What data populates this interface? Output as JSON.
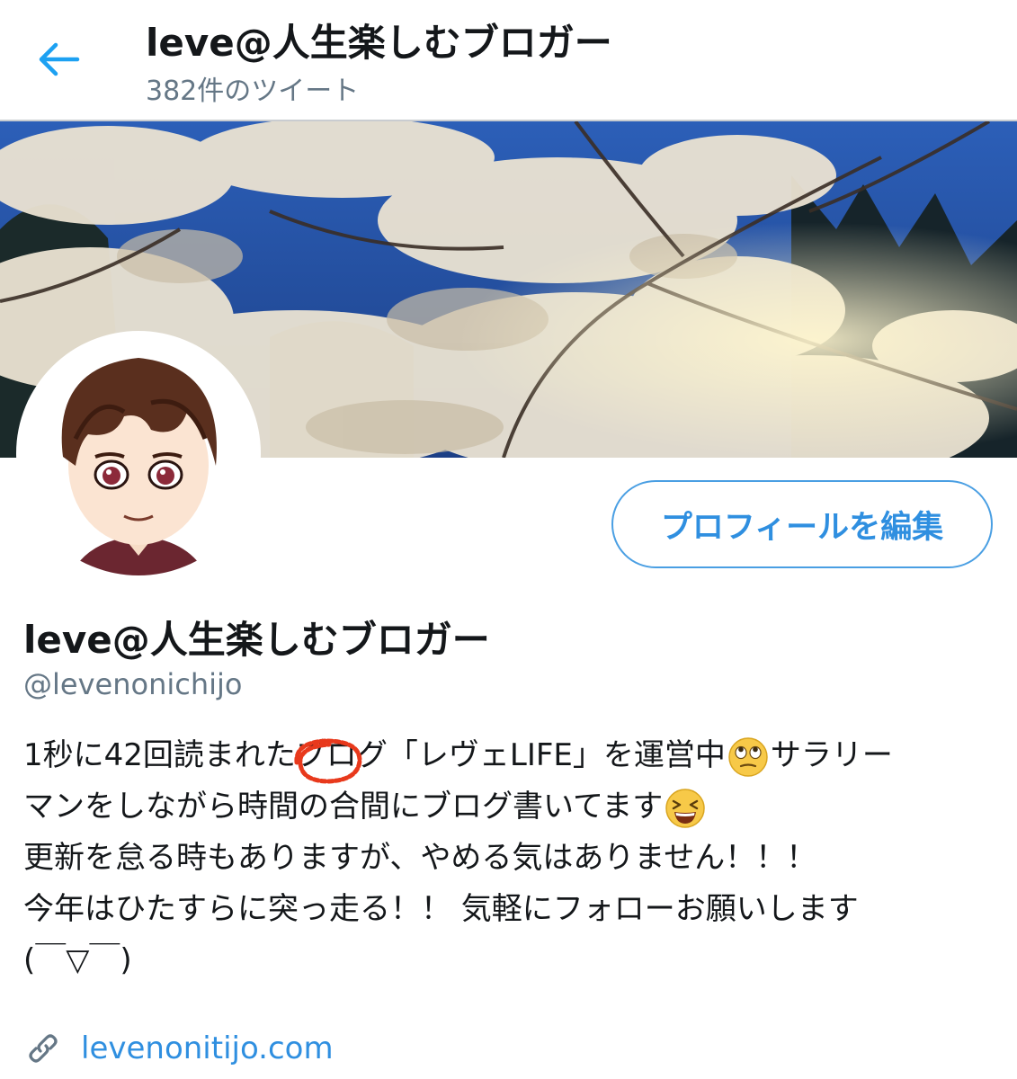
{
  "header": {
    "back_icon": "arrow-left-icon",
    "title": "leve@人生楽しむブロガー",
    "tweet_count": "382件のツイート"
  },
  "profile": {
    "edit_button": "プロフィールを編集",
    "display_name": "leve@人生楽しむブロガー",
    "handle": "@levenonichijo",
    "bio": {
      "line1_a": "1秒に42回読まれたブログ「レヴェLIFE」を運営中",
      "line1_emoji": "rolling-eyes-emoji",
      "line1_b": "サラリー",
      "line2_a": "マンをしながら時間の合間にブログ書いてます",
      "line2_emoji": "grinning-squinting-emoji",
      "line3": "更新を怠る時もありますが、やめる気はありません！！！",
      "line4": "今年はひたすらに突っ走る！！ 気軽にフォローお願いします",
      "line5": "(￣▽￣)"
    },
    "link_icon": "link-icon",
    "website": "levenonitijo.com"
  },
  "colors": {
    "accent": "#2f8fe0",
    "muted": "#657786",
    "text": "#14171a",
    "highlight_circle": "#e8391c"
  }
}
